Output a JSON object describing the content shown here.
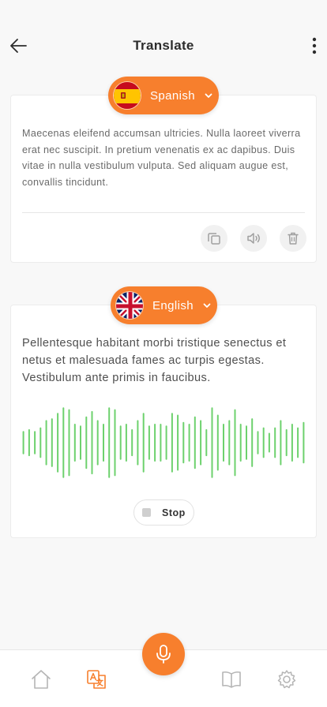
{
  "header": {
    "title": "Translate"
  },
  "source": {
    "language": "Spanish",
    "text": "Maecenas eleifend accumsan ultricies. Nulla laoreet viverra erat nec suscipit. In pretium venenatis ex ac dapibus. Duis vitae in nulla vestibulum vulputa. Sed aliquam augue est, convallis tincidunt."
  },
  "target": {
    "language": "English",
    "text": "Pellentesque habitant morbi tristique senectus et netus et malesuada fames ac turpis egestas. Vestibulum ante primis in faucibus.",
    "stop_label": "Stop",
    "waveform_levels": [
      0.3,
      0.35,
      0.3,
      0.4,
      0.6,
      0.65,
      0.8,
      0.95,
      0.9,
      0.5,
      0.45,
      0.7,
      0.85,
      0.6,
      0.5,
      0.95,
      0.9,
      0.45,
      0.5,
      0.35,
      0.6,
      0.8,
      0.45,
      0.5,
      0.5,
      0.45,
      0.8,
      0.75,
      0.55,
      0.5,
      0.7,
      0.6,
      0.35,
      0.95,
      0.75,
      0.5,
      0.6,
      0.9,
      0.5,
      0.45,
      0.65,
      0.3,
      0.4,
      0.25,
      0.4,
      0.6,
      0.35,
      0.5,
      0.4,
      0.55
    ],
    "waveform_color": "#6dd16d"
  },
  "colors": {
    "accent": "#f77f2d"
  },
  "nav": {
    "items": [
      "home-icon",
      "translate-icon",
      "book-icon",
      "settings-icon"
    ],
    "active": "translate-icon"
  }
}
